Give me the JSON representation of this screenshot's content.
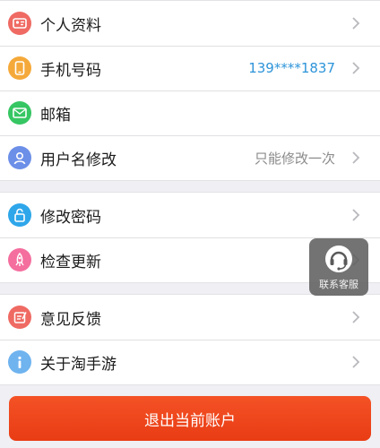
{
  "groups": [
    {
      "items": [
        {
          "label": "个人资料",
          "value": "",
          "icon": "profile-card-icon",
          "color": "#ef6a63"
        },
        {
          "label": "手机号码",
          "value": "139****1837",
          "icon": "phone-icon",
          "color": "#f5a93a"
        },
        {
          "label": "邮箱",
          "value": "",
          "icon": "mail-icon",
          "color": "#36c663"
        },
        {
          "label": "用户名修改",
          "value": "只能修改一次",
          "icon": "user-icon",
          "color": "#6c8fe8"
        }
      ]
    },
    {
      "items": [
        {
          "label": "修改密码",
          "value": "",
          "icon": "lock-icon",
          "color": "#2ea6ea"
        },
        {
          "label": "检查更新",
          "value": "",
          "icon": "rocket-icon",
          "color": "#f46e9e"
        }
      ]
    },
    {
      "items": [
        {
          "label": "意见反馈",
          "value": "",
          "icon": "feedback-icon",
          "color": "#ef6a63"
        },
        {
          "label": "关于淘手游",
          "value": "",
          "icon": "info-icon",
          "color": "#6fb3ef"
        }
      ]
    }
  ],
  "logout_label": "退出当前账户",
  "customer_service": {
    "label": "联系客服",
    "icon": "headset-icon"
  }
}
